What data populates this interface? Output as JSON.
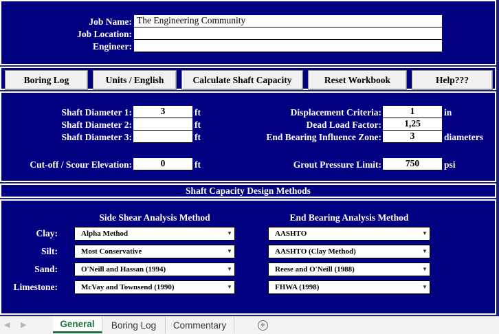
{
  "job": {
    "name_label": "Job Name:",
    "name_value": "The Engineering Community",
    "location_label": "Job Location:",
    "location_value": "",
    "engineer_label": "Engineer:",
    "engineer_value": ""
  },
  "toolbar": {
    "boring_log": "Boring Log",
    "units": "Units / English",
    "calculate": "Calculate Shaft Capacity",
    "reset": "Reset Workbook",
    "help": "Help???"
  },
  "shaft": {
    "d1_label": "Shaft Diameter 1:",
    "d1_value": "3",
    "d1_unit": "ft",
    "d2_label": "Shaft Diameter 2:",
    "d2_value": "",
    "d2_unit": "ft",
    "d3_label": "Shaft Diameter 3:",
    "d3_value": "",
    "d3_unit": "ft",
    "cutoff_label": "Cut-off / Scour Elevation:",
    "cutoff_value": "0",
    "cutoff_unit": "ft",
    "disp_label": "Displacement Criteria:",
    "disp_value": "1",
    "disp_unit": "in",
    "dead_label": "Dead Load Factor:",
    "dead_value": "1,25",
    "endzone_label": "End Bearing Influence Zone:",
    "endzone_value": "3",
    "endzone_unit": "diameters",
    "grout_label": "Grout Pressure Limit:",
    "grout_value": "750",
    "grout_unit": "psi"
  },
  "methods": {
    "title": "Shaft Capacity Design Methods",
    "side_header": "Side Shear Analysis Method",
    "end_header": "End Bearing Analysis Method",
    "rows": [
      {
        "soil": "Clay:",
        "side": "Alpha Method",
        "end": "AASHTO"
      },
      {
        "soil": "Silt:",
        "side": "Most Conservative",
        "end": "AASHTO (Clay Method)"
      },
      {
        "soil": "Sand:",
        "side": "O'Neill and Hassan (1994)",
        "end": "Reese and O'Neill (1988)"
      },
      {
        "soil": "Limestone:",
        "side": "McVay and Townsend (1990)",
        "end": "FHWA (1998)"
      }
    ]
  },
  "sheet_tabs": [
    "General",
    "Boring Log",
    "Commentary"
  ],
  "colors": {
    "panel": "#000080",
    "tab_active": "#217346"
  }
}
